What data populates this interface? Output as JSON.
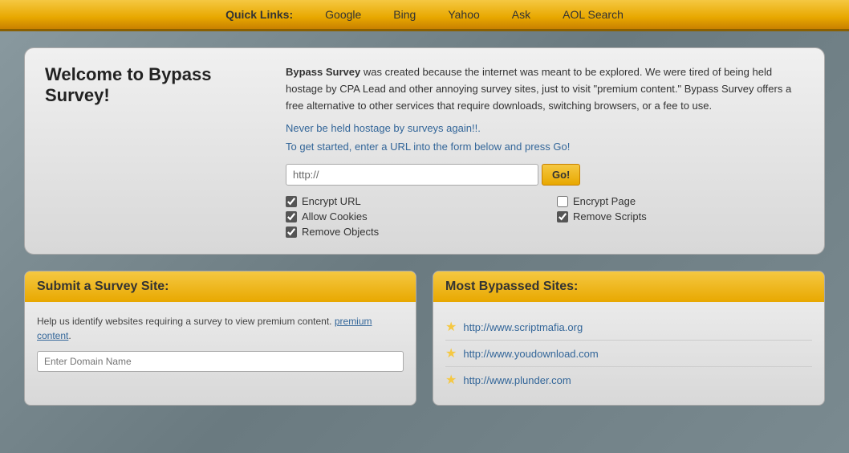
{
  "nav": {
    "quick_links_label": "Quick Links:",
    "links": [
      {
        "label": "Google",
        "url": "http://www.google.com"
      },
      {
        "label": "Bing",
        "url": "http://www.bing.com"
      },
      {
        "label": "Yahoo",
        "url": "http://www.yahoo.com"
      },
      {
        "label": "Ask",
        "url": "http://www.ask.com"
      },
      {
        "label": "AOL Search",
        "url": "http://search.aol.com"
      }
    ]
  },
  "welcome": {
    "title": "Welcome to Bypass Survey!",
    "description_bold": "Bypass Survey",
    "description_rest": " was created because the internet was meant to be explored. We were tired of being held hostage by CPA Lead and other annoying survey sites, just to visit \"premium content.\" Bypass Survey offers a free alternative to other services that require downloads, switching browsers, or a fee to use.",
    "tagline": "Never be held hostage by surveys again!!.",
    "cta": "To get started, enter a URL into the form below and press Go!",
    "url_placeholder": "http://",
    "go_button": "Go!",
    "options": [
      {
        "label": "Encrypt URL",
        "checked": true,
        "col": 1
      },
      {
        "label": "Encrypt Page",
        "checked": false,
        "col": 2
      },
      {
        "label": "Allow Cookies",
        "checked": true,
        "col": 1
      },
      {
        "label": "Remove Scripts",
        "checked": true,
        "col": 2
      },
      {
        "label": "Remove Objects",
        "checked": true,
        "col": 1
      }
    ]
  },
  "submit_panel": {
    "header": "Submit a Survey Site:",
    "description": "Help us identify websites requiring a survey to view premium content.",
    "input_placeholder": "Enter Domain Name"
  },
  "bypassed_panel": {
    "header": "Most Bypassed Sites:",
    "sites": [
      {
        "label": "http://www.scriptmafia.org",
        "url": "http://www.scriptmafia.org"
      },
      {
        "label": "http://www.youdownload.com",
        "url": "http://www.youdownload.com"
      },
      {
        "label": "http://www.plunder.com",
        "url": "http://www.plunder.com"
      }
    ]
  }
}
